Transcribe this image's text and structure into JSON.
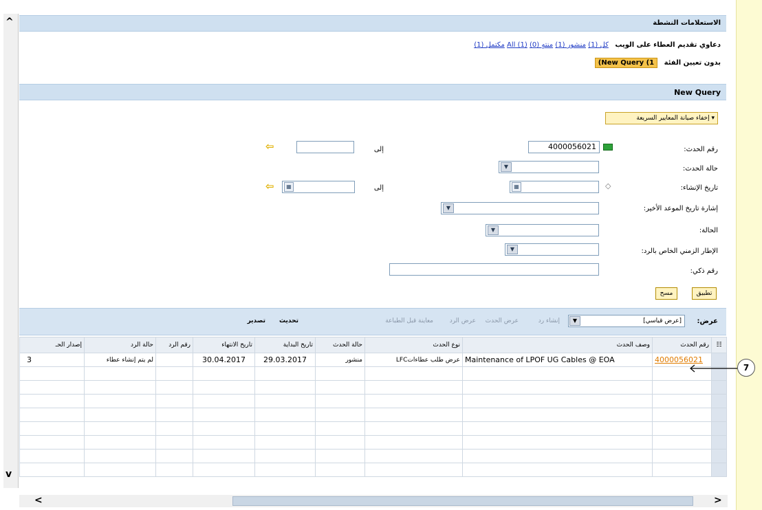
{
  "header": {
    "band_title": "الاستعلامات النشطة",
    "row1_label": "دعاوي تقديم العطاء على الويب",
    "row1_links": [
      "كل (1)",
      "منشور (1)",
      "منتهٍ (0)",
      "(1) All",
      "مكتمل (1)"
    ],
    "row2_label": "بدون تعيين الفئة",
    "new_query_chip": "(New Query (1"
  },
  "query_band": {
    "title": "New Query",
    "toggle": "▾ إخفاء صيانة المعايير السريعة"
  },
  "form": {
    "event_number_label": "رقم الحدث:",
    "event_number_value": "4000056021",
    "to_label": "إلى",
    "event_status_label": "حالة الحدث:",
    "created_date_label": "تاريخ الإنشاء:",
    "deadline_label": "إشارة تاريخ الموعد الأخير:",
    "status_label": "الحالة:",
    "response_timeframe_label": "الإطار الزمني الخاص بالرد:",
    "smart_number_label": "رقم ذكي:",
    "apply_button": "تطبيق",
    "clear_button": "مسح"
  },
  "toolbar": {
    "view_label": "عرض:",
    "view_value": "[عرض قياسي]",
    "create_response": "إنشاء رد",
    "display_event": "عرض الحدث",
    "display_response": "عرض الرد",
    "print_preview": "معاينة قبل الطباعة",
    "refresh": "تحديث",
    "export": "تصدير"
  },
  "table": {
    "headers": [
      "رقم الحدث",
      "وصف الحدث",
      "نوع الحدث",
      "حالة الحدث",
      "تاريخ البداية",
      "تاريخ الانتهاء",
      "رقم الرد",
      "حالة الرد",
      "إصدار الحـ"
    ],
    "row": {
      "event_number": "4000056021",
      "description": "Maintenance of LPOF UG Cables @ EOA",
      "event_type": "عرض طلب عطاءاتLFC",
      "event_status": "منشور",
      "start_date": "29.03.2017",
      "end_date": "30.04.2017",
      "response_number": "",
      "response_status": "لم يتم إنشاء عطاء",
      "version": "3"
    }
  },
  "callout": {
    "number": "7"
  },
  "icons": {
    "scroll_up": "▲",
    "scroll_down": "▼",
    "scroll_left": "◀",
    "scroll_right": "▶"
  }
}
